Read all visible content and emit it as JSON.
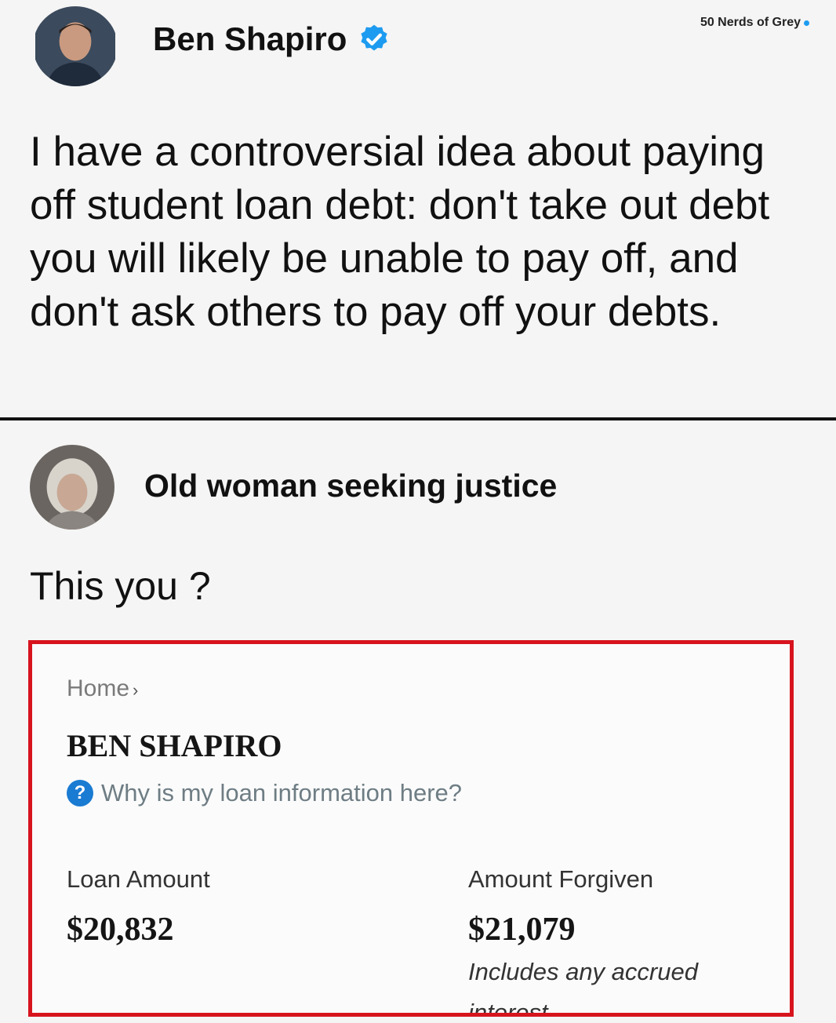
{
  "watermark": "50 Nerds of Grey",
  "post": {
    "author": "Ben Shapiro",
    "text": "I have a controversial idea about paying off student loan debt: don't take out debt you will likely be unable to pay off, and don't ask others to pay off your debts."
  },
  "reply": {
    "author": "Old woman seeking justice",
    "text": "This you ?"
  },
  "embedded": {
    "breadcrumb": "Home",
    "breadcrumb_separator": "›",
    "name": "BEN SHAPIRO",
    "help_link": "Why is my loan information here?",
    "loan_amount_label": "Loan Amount",
    "loan_amount_value": "$20,832",
    "forgiven_label": "Amount Forgiven",
    "forgiven_value": "$21,079",
    "forgiven_note": "Includes any accrued interest"
  },
  "colors": {
    "verified": "#1d9bf0",
    "highlight_border": "#d7141e",
    "help_icon": "#1a7bd2"
  }
}
